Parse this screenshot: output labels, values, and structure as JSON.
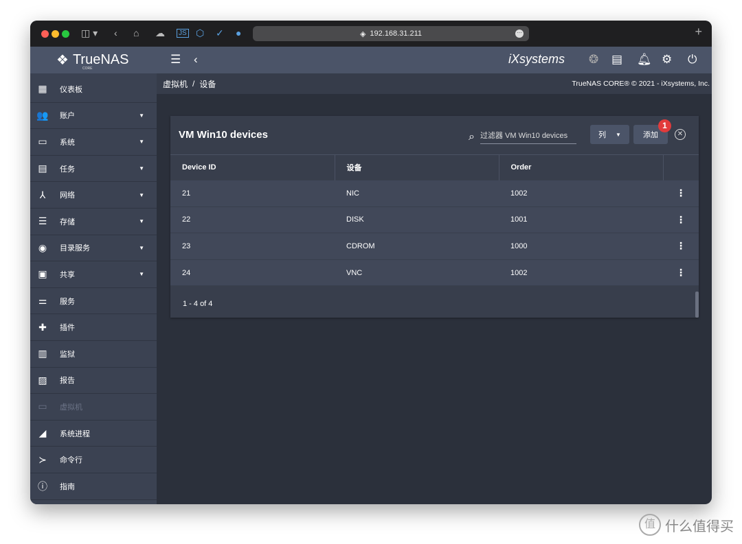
{
  "browser": {
    "url": "192.168.31.211"
  },
  "header": {
    "logo": "TrueNAS",
    "logo_sub": "CORE",
    "vendor": "iXsystems"
  },
  "breadcrumb": {
    "parent": "虚拟机",
    "sep": "/",
    "current": "设备",
    "copyright": "TrueNAS CORE® © 2021 - iXsystems, Inc."
  },
  "sidebar": {
    "items": [
      {
        "label": "仪表板",
        "icon": "▦",
        "caret": false
      },
      {
        "label": "账户",
        "icon": "👥",
        "caret": true
      },
      {
        "label": "系统",
        "icon": "▭",
        "caret": true
      },
      {
        "label": "任务",
        "icon": "▤",
        "caret": true
      },
      {
        "label": "网络",
        "icon": "⅄",
        "caret": true
      },
      {
        "label": "存储",
        "icon": "☰",
        "caret": true
      },
      {
        "label": "目录服务",
        "icon": "◉",
        "caret": true
      },
      {
        "label": "共享",
        "icon": "▣",
        "caret": true
      },
      {
        "label": "服务",
        "icon": "⚌",
        "caret": false
      },
      {
        "label": "插件",
        "icon": "✚",
        "caret": false
      },
      {
        "label": "监狱",
        "icon": "▥",
        "caret": false
      },
      {
        "label": "报告",
        "icon": "▨",
        "caret": false
      },
      {
        "label": "虚拟机",
        "icon": "▭",
        "caret": false,
        "disabled": true
      },
      {
        "label": "系统进程",
        "icon": "◢",
        "caret": false
      },
      {
        "label": "命令行",
        "icon": "≻",
        "caret": false
      },
      {
        "label": "指南",
        "icon": "ⓘ",
        "caret": false
      }
    ]
  },
  "card": {
    "title": "VM Win10 devices",
    "filter_placeholder": "过滤器 VM Win10 devices",
    "columns_button": "列",
    "add_button": "添加",
    "badge": "1",
    "headers": [
      "Device ID",
      "设备",
      "Order"
    ],
    "rows": [
      [
        "21",
        "NIC",
        "1002"
      ],
      [
        "22",
        "DISK",
        "1001"
      ],
      [
        "23",
        "CDROM",
        "1000"
      ],
      [
        "24",
        "VNC",
        "1002"
      ]
    ],
    "pager": "1 - 4 of 4"
  },
  "watermark": "什么值得买"
}
